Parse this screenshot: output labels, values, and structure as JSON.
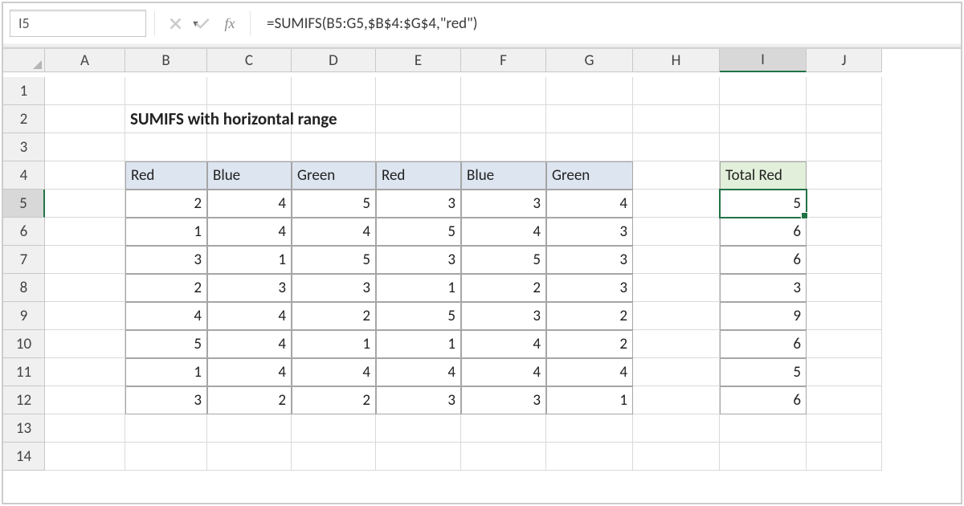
{
  "name_box": "I5",
  "formula": "=SUMIFS(B5:G5,$B$4:$G$4,\"red\")",
  "fx_label": "fx",
  "columns": [
    "A",
    "B",
    "C",
    "D",
    "E",
    "F",
    "G",
    "H",
    "I",
    "J"
  ],
  "rows": [
    "1",
    "2",
    "3",
    "4",
    "5",
    "6",
    "7",
    "8",
    "9",
    "10",
    "11",
    "12",
    "13",
    "14"
  ],
  "active_col": "I",
  "active_row": "5",
  "title": "SUMIFS with horizontal range",
  "table_headers": [
    "Red",
    "Blue",
    "Green",
    "Red",
    "Blue",
    "Green"
  ],
  "table_rows": [
    [
      2,
      4,
      5,
      3,
      3,
      4
    ],
    [
      1,
      4,
      4,
      5,
      4,
      3
    ],
    [
      3,
      1,
      5,
      3,
      5,
      3
    ],
    [
      2,
      3,
      3,
      1,
      2,
      3
    ],
    [
      4,
      4,
      2,
      5,
      3,
      2
    ],
    [
      5,
      4,
      1,
      1,
      4,
      2
    ],
    [
      1,
      4,
      4,
      4,
      4,
      4
    ],
    [
      3,
      2,
      2,
      3,
      3,
      1
    ]
  ],
  "total_header": "Total Red",
  "total_values": [
    5,
    6,
    6,
    3,
    9,
    6,
    5,
    6
  ]
}
